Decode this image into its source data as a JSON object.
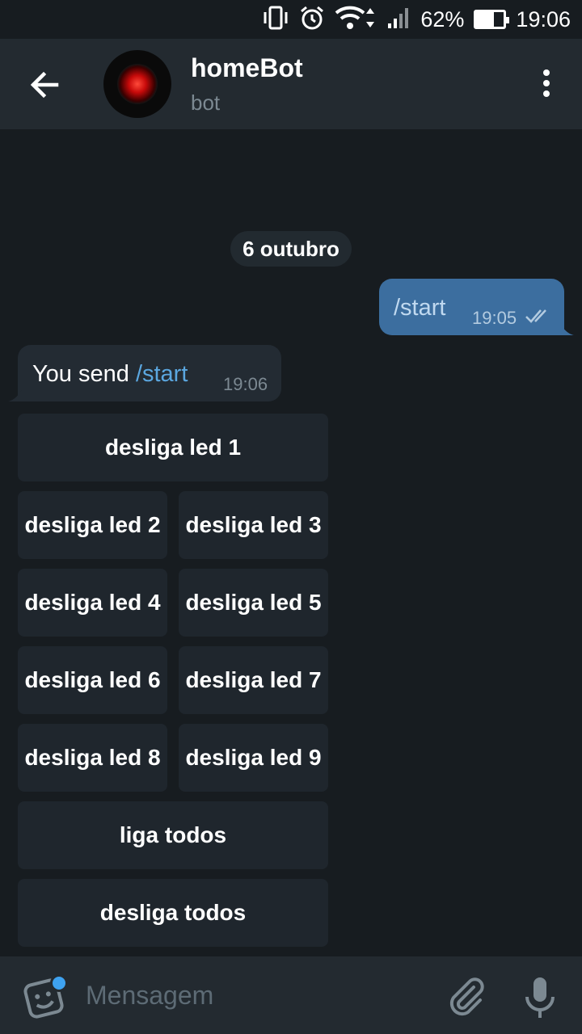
{
  "status_bar": {
    "battery_level": "62%",
    "battery_fraction": 0.62,
    "time": "19:06",
    "icons": [
      "vibrate-icon",
      "alarm-icon",
      "wifi-icon",
      "signal-icon",
      "battery-icon"
    ]
  },
  "header": {
    "title": "homeBot",
    "subtitle": "bot"
  },
  "chat": {
    "date_label": "6 outubro",
    "outgoing": {
      "text": "/start",
      "time": "19:05"
    },
    "incoming": {
      "text": "You send ",
      "command": "/start",
      "time": "19:06"
    }
  },
  "keyboard": {
    "rows": [
      [
        "desliga led 1"
      ],
      [
        "desliga led 2",
        "desliga led 3"
      ],
      [
        "desliga led 4",
        "desliga led 5"
      ],
      [
        "desliga led 6",
        "desliga led 7"
      ],
      [
        "desliga led 8",
        "desliga led 9"
      ],
      [
        "liga todos"
      ],
      [
        "desliga todos"
      ]
    ]
  },
  "input": {
    "placeholder": "Mensagem"
  },
  "colors": {
    "background": "#171c20",
    "header": "#232a30",
    "outgoing_bubble": "#3c6e9f",
    "incoming_bubble": "#232b33",
    "link": "#5ba7e0",
    "notification_dot": "#3ea2f0"
  }
}
